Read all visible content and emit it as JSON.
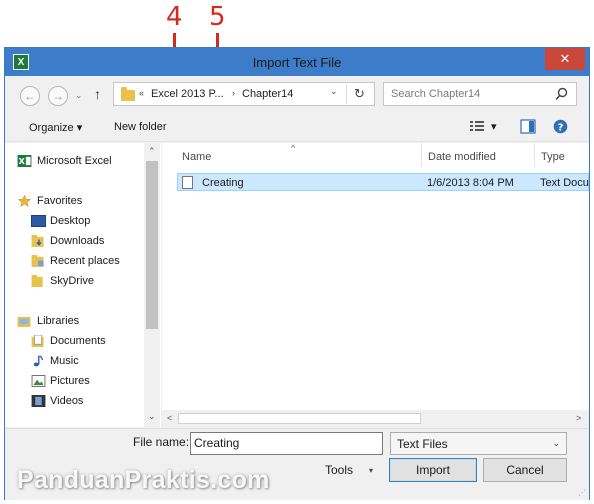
{
  "callouts": [
    "4",
    "5"
  ],
  "window": {
    "title": "Import Text File",
    "app_icon": "X",
    "close_glyph": "✕"
  },
  "nav": {
    "back": "←",
    "forward": "→",
    "up": "↑",
    "down_glyph": "⌄"
  },
  "address": {
    "prefix": "«",
    "segments": [
      "Excel 2013 P...",
      "Chapter14"
    ],
    "separator": "›",
    "dropdown": "⌄",
    "refresh": "↻"
  },
  "search": {
    "placeholder": "Search Chapter14"
  },
  "toolbar": {
    "organize": "Organize",
    "organize_caret": "▾",
    "new_folder": "New folder",
    "view_caret": "▾",
    "help": "?"
  },
  "navpane": {
    "top_item": "Microsoft Excel",
    "favorites_label": "Favorites",
    "favorites": [
      "Desktop",
      "Downloads",
      "Recent places",
      "SkyDrive"
    ],
    "libraries_label": "Libraries",
    "libraries": [
      "Documents",
      "Music",
      "Pictures",
      "Videos"
    ],
    "scroll_up": "⌃",
    "scroll_down": "⌄"
  },
  "filelist": {
    "columns": [
      "Name",
      "Date modified",
      "Type"
    ],
    "sort_indicator": "^",
    "rows": [
      {
        "name": "Creating",
        "date": "1/6/2013 8:04 PM",
        "type": "Text Docu"
      }
    ],
    "scroll_left": "<",
    "scroll_right": ">"
  },
  "footer": {
    "file_name_label": "File name:",
    "file_name_value": "Creating",
    "file_type": "Text Files",
    "file_type_caret": "⌄",
    "tools": "Tools",
    "tools_caret": "▾",
    "import": "Import",
    "cancel": "Cancel",
    "grip": "⋰"
  },
  "watermark": "PanduanPraktis.com",
  "colors": {
    "titlebar": "#3c7cc9",
    "close": "#c9483a",
    "selection": "#cce8ff",
    "callout": "#d42a1e"
  }
}
